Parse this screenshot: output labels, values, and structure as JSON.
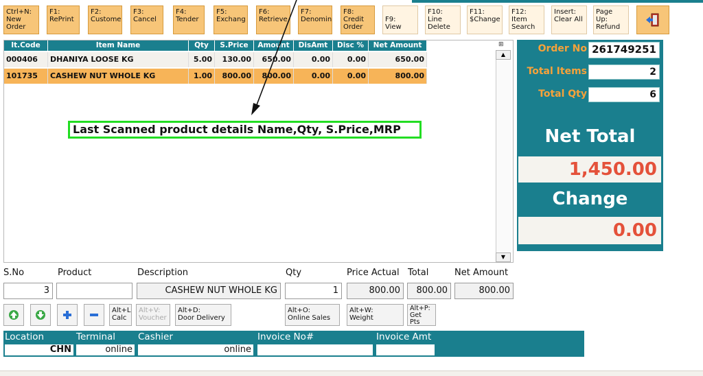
{
  "toolbar": {
    "keys": [
      {
        "label": "Ctrl+N:\nNew\nOrder"
      },
      {
        "label": "F1:\nRePrint"
      },
      {
        "label": "F2:\nCustome"
      },
      {
        "label": "F3:\nCancel"
      },
      {
        "label": "F4:\nTender"
      },
      {
        "label": "F5:\nExchang"
      },
      {
        "label": "F6:\nRetrieve"
      },
      {
        "label": "F7:\nDenomin"
      },
      {
        "label": "F8:\nCredit\nOrder"
      },
      {
        "label": "F9:\nView"
      },
      {
        "label": "F10:\nLine\nDelete"
      },
      {
        "label": "F11:\n$Change"
      },
      {
        "label": "F12:\nItem\nSearch"
      },
      {
        "label": "Insert:\nClear All"
      },
      {
        "label": "Page\nUp:\nRefund"
      }
    ],
    "exit_icon": "exit-door-icon"
  },
  "grid": {
    "columns": [
      "It.Code",
      "Item Name",
      "Qty",
      "S.Price",
      "Amount",
      "DisAmt",
      "Disc %",
      "Net Amount"
    ],
    "rows": [
      {
        "code": "000406",
        "name": "DHANIYA LOOSE KG",
        "qty": "5.00",
        "sprice": "130.00",
        "amount": "650.00",
        "disamt": "0.00",
        "disc": "0.00",
        "net": "650.00"
      },
      {
        "code": "101735",
        "name": "CASHEW NUT WHOLE KG",
        "qty": "1.00",
        "sprice": "800.00",
        "amount": "800.00",
        "disamt": "0.00",
        "disc": "0.00",
        "net": "800.00"
      }
    ],
    "selected_row": 1
  },
  "annotation": {
    "text": "Last Scanned product details Name,Qty, S.Price,MRP",
    "border_color": "#22dd22"
  },
  "summary": {
    "order_no_label": "Order No",
    "order_no": "261749251",
    "total_items_label": "Total Items",
    "total_items": "2",
    "total_qty_label": "Total Qty",
    "total_qty": "6",
    "net_total_label": "Net Total",
    "net_total": "1,450.00",
    "change_label": "Change",
    "change": "0.00"
  },
  "entry": {
    "sno_label": "S.No",
    "sno": "3",
    "product_label": "Product",
    "product": "",
    "description_label": "Description",
    "description": "CASHEW NUT WHOLE KG",
    "qty_label": "Qty",
    "qty": "1",
    "price_actual_label": "Price Actual",
    "price_actual": "800.00",
    "total_label": "Total",
    "total": "800.00",
    "net_amount_label": "Net Amount",
    "net_amount": "800.00"
  },
  "actions": {
    "calc": "Alt+L:\nCalc",
    "voucher": "Alt+V:\nVoucher",
    "door_delivery": "Alt+D:\nDoor Delivery",
    "online_sales": "Alt+O:\nOnline Sales",
    "weight": "Alt+W:\nWeight",
    "get_pts": "Alt+P:\nGet\nPts"
  },
  "footer": {
    "location_label": "Location",
    "location": "CHN",
    "terminal_label": "Terminal",
    "terminal": "online",
    "cashier_label": "Cashier",
    "cashier": "online",
    "invoice_no_label": "Invoice No#",
    "invoice_no": "",
    "invoice_amt_label": "Invoice Amt",
    "invoice_amt": ""
  },
  "colors": {
    "teal": "#1a7f8e",
    "orange_key": "#f7c578",
    "selected_row": "#f7b458",
    "amount_red": "#e4513a",
    "label_orange": "#f7a23a"
  }
}
